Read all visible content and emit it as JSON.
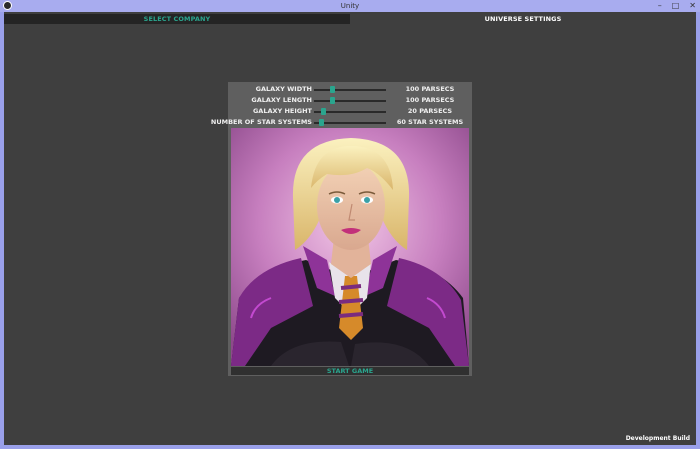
{
  "window": {
    "title": "Unity",
    "minimize": "–",
    "maximize": "□",
    "close": "✕"
  },
  "tabs": {
    "company": "SELECT COMPANY",
    "universe": "UNIVERSE SETTINGS"
  },
  "settings": [
    {
      "label": "GALAXY WIDTH",
      "value": "100 PARSECS",
      "slider_fraction": 0.24
    },
    {
      "label": "GALAXY LENGTH",
      "value": "100 PARSECS",
      "slider_fraction": 0.24
    },
    {
      "label": "GALAXY HEIGHT",
      "value": "20 PARSECS",
      "slider_fraction": 0.1
    },
    {
      "label": "NUMBER OF STAR SYSTEMS",
      "value": "60 STAR SYSTEMS",
      "slider_fraction": 0.08
    }
  ],
  "start_label": "START GAME",
  "footer": {
    "build": "Development Build"
  },
  "colors": {
    "accent": "#2aa58e",
    "background": "#3f3f3f",
    "panel": "#5f5f5f",
    "frame": "#9aa0ea"
  }
}
